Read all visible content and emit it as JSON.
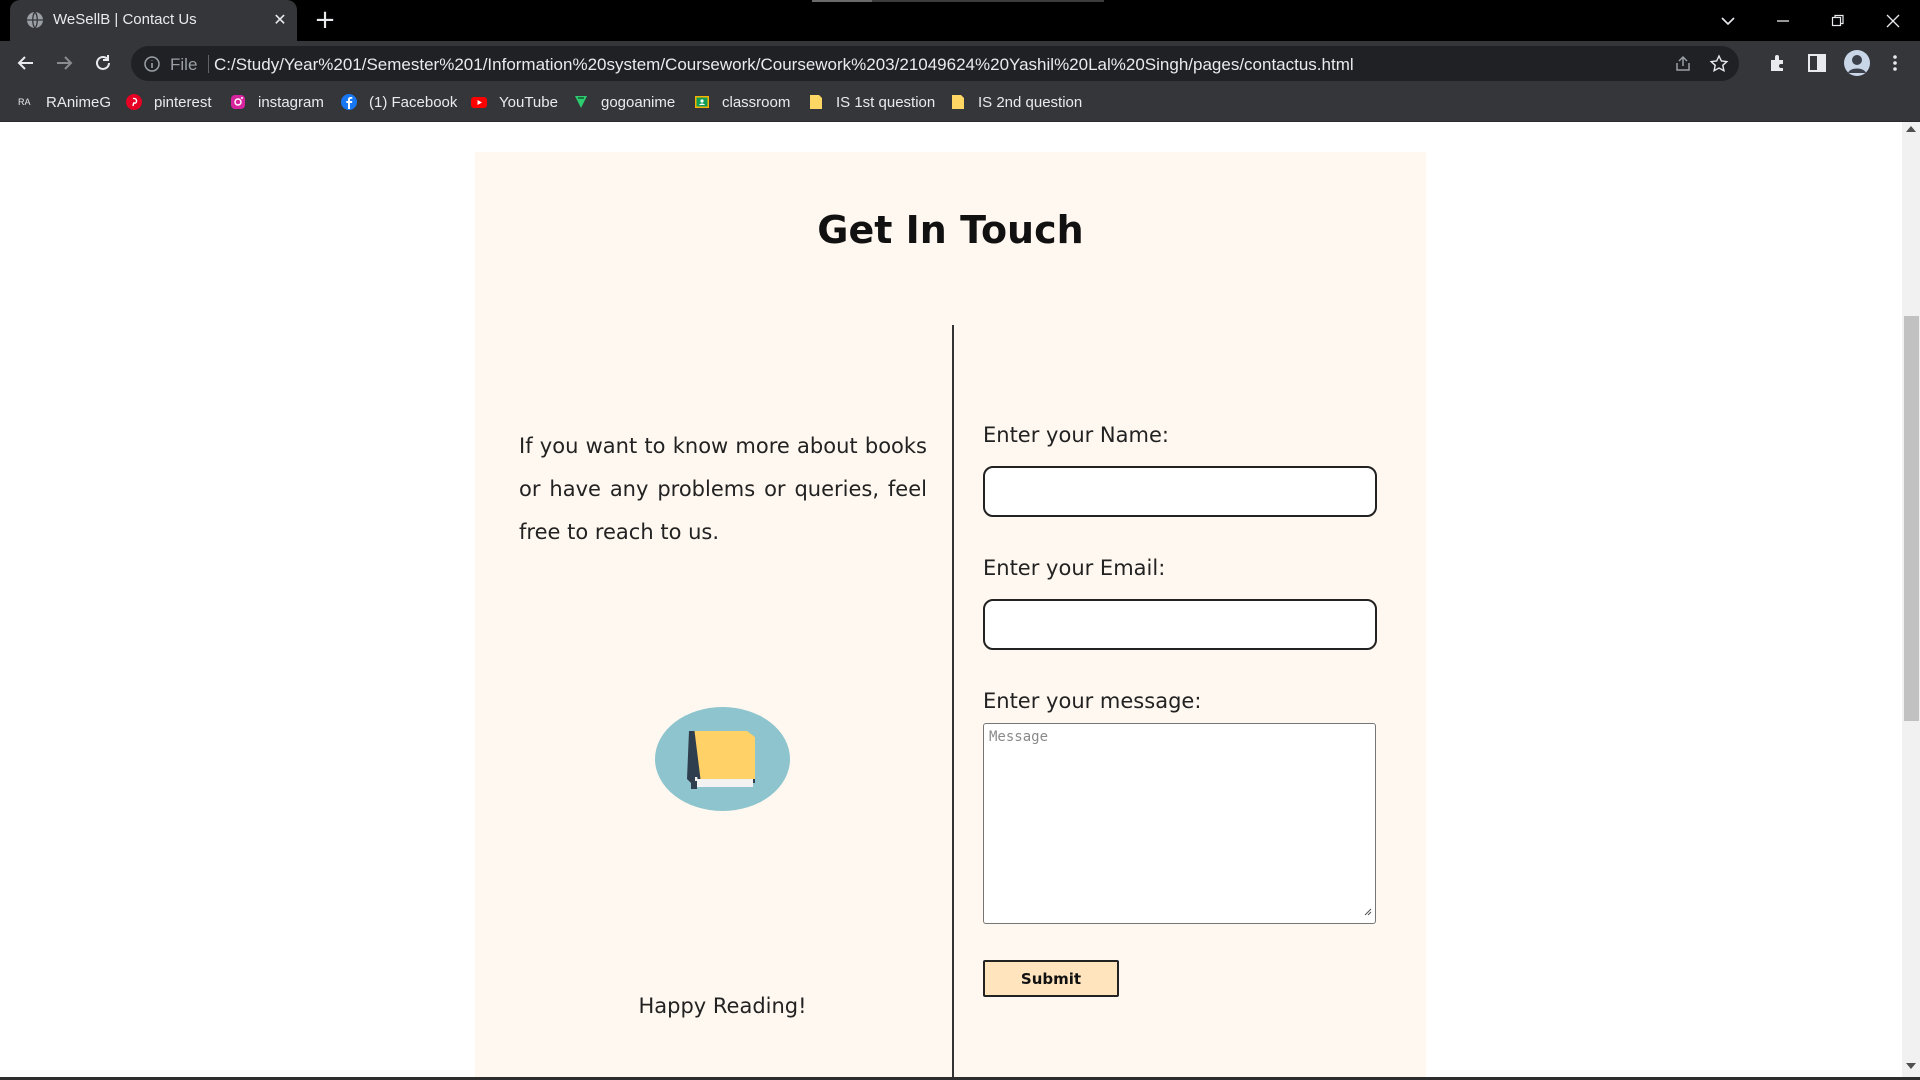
{
  "browser": {
    "tab_title": "WeSellB | Contact Us",
    "address_scheme_label": "File",
    "address_url": "C:/Study/Year%201/Semester%201/Information%20system/Coursework/Coursework%203/21049624%20Yashil%20Lal%20Singh/pages/contactus.html",
    "bookmarks": [
      {
        "label": "RAnimeG",
        "icon": "ranimeg-icon"
      },
      {
        "label": "pinterest",
        "icon": "pinterest-icon"
      },
      {
        "label": "instagram",
        "icon": "instagram-icon"
      },
      {
        "label": "(1) Facebook",
        "icon": "facebook-icon"
      },
      {
        "label": "YouTube",
        "icon": "youtube-icon"
      },
      {
        "label": "gogoanime",
        "icon": "gogoanime-icon"
      },
      {
        "label": "classroom",
        "icon": "classroom-icon"
      },
      {
        "label": "IS 1st question",
        "icon": "folder-icon"
      },
      {
        "label": "IS 2nd question",
        "icon": "folder-icon"
      }
    ],
    "favicon_text": "RA"
  },
  "page": {
    "heading": "Get In Touch",
    "intro": "If you want to know more about books or have any problems or queries, feel free to reach to us.",
    "closing": "Happy Reading!",
    "form": {
      "name_label": "Enter your Name:",
      "name_value": "",
      "email_label": "Enter your Email:",
      "email_value": "",
      "message_label": "Enter your message:",
      "message_placeholder": "Message",
      "submit_label": "Submit"
    }
  },
  "colors": {
    "card_background": "#fff8f0",
    "submit_background": "#ffe4bd",
    "book_circle": "#8ec4cd",
    "book_cover": "#ffd166",
    "book_spine": "#2f3e4e"
  }
}
